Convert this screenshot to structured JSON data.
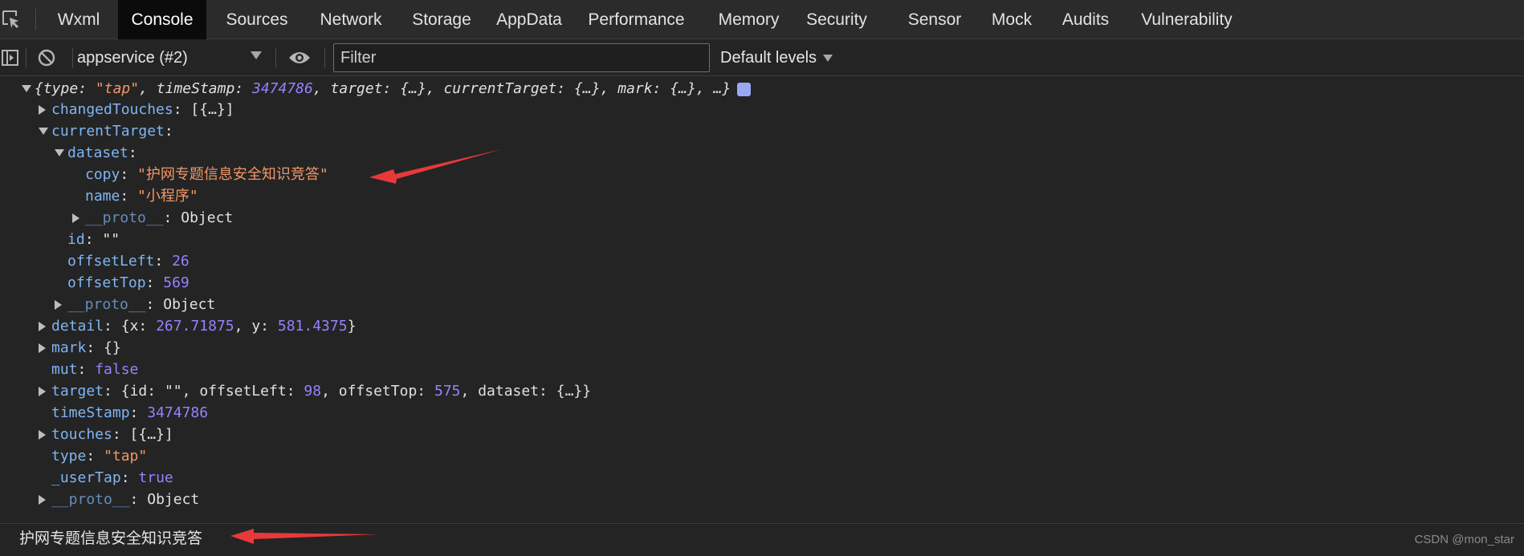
{
  "tabs": [
    {
      "label": "Wxml",
      "active": false
    },
    {
      "label": "Console",
      "active": true
    },
    {
      "label": "Sources",
      "active": false
    },
    {
      "label": "Network",
      "active": false
    },
    {
      "label": "Storage",
      "active": false
    },
    {
      "label": "AppData",
      "active": false
    },
    {
      "label": "Performance",
      "active": false
    },
    {
      "label": "Memory",
      "active": false
    },
    {
      "label": "Security",
      "active": false
    },
    {
      "label": "Sensor",
      "active": false
    },
    {
      "label": "Mock",
      "active": false
    },
    {
      "label": "Audits",
      "active": false
    },
    {
      "label": "Vulnerability",
      "active": false
    }
  ],
  "toolbar": {
    "context": "appservice (#2)",
    "filter_placeholder": "Filter",
    "levels": "Default levels"
  },
  "console": {
    "summary": {
      "open": "{",
      "k_type": "type",
      "v_type": "\"tap\"",
      "k_timeStamp": "timeStamp",
      "v_timeStamp": "3474786",
      "k_target": "target",
      "v_target": "{…}",
      "k_currentTarget": "currentTarget",
      "v_currentTarget": "{…}",
      "k_mark": "mark",
      "v_mark": "{…}",
      "tail": ", …}"
    },
    "changedTouches": {
      "key": "changedTouches",
      "value": "[{…}]"
    },
    "currentTarget": {
      "key": "currentTarget"
    },
    "dataset": {
      "key": "dataset"
    },
    "copy": {
      "key": "copy",
      "value": "\"护网专题信息安全知识竞答\""
    },
    "name": {
      "key": "name",
      "value": "\"小程序\""
    },
    "proto_inner": {
      "key": "__proto__",
      "value": "Object"
    },
    "id": {
      "key": "id",
      "value": "\"\""
    },
    "offsetLeft": {
      "key": "offsetLeft",
      "value": "26"
    },
    "offsetTop": {
      "key": "offsetTop",
      "value": "569"
    },
    "proto_ct": {
      "key": "__proto__",
      "value": "Object"
    },
    "detail": {
      "key": "detail",
      "open": "{",
      "kx": "x",
      "vx": "267.71875",
      "ky": "y",
      "vy": "581.4375",
      "close": "}"
    },
    "mark": {
      "key": "mark",
      "value": "{}"
    },
    "mut": {
      "key": "mut",
      "value": "false"
    },
    "target": {
      "key": "target",
      "open": "{",
      "k_id": "id",
      "v_id": "\"\"",
      "k_ol": "offsetLeft",
      "v_ol": "98",
      "k_ot": "offsetTop",
      "v_ot": "575",
      "k_ds": "dataset",
      "v_ds": "{…}",
      "close": "}"
    },
    "timeStamp": {
      "key": "timeStamp",
      "value": "3474786"
    },
    "touches": {
      "key": "touches",
      "value": "[{…}]"
    },
    "type": {
      "key": "type",
      "value": "\"tap\""
    },
    "userTap": {
      "key": "_userTap",
      "value": "true"
    },
    "proto_root": {
      "key": "__proto__",
      "value": "Object"
    }
  },
  "output_text": "护网专题信息安全知识竞答",
  "watermark": "CSDN @mon_star",
  "colors": {
    "tabbar_bg": "#2b2b2b",
    "console_bg": "#242424",
    "key": "#7fb5f2",
    "string": "#f29766",
    "number": "#9980ff",
    "annotation_arrow": "#e8393a"
  }
}
